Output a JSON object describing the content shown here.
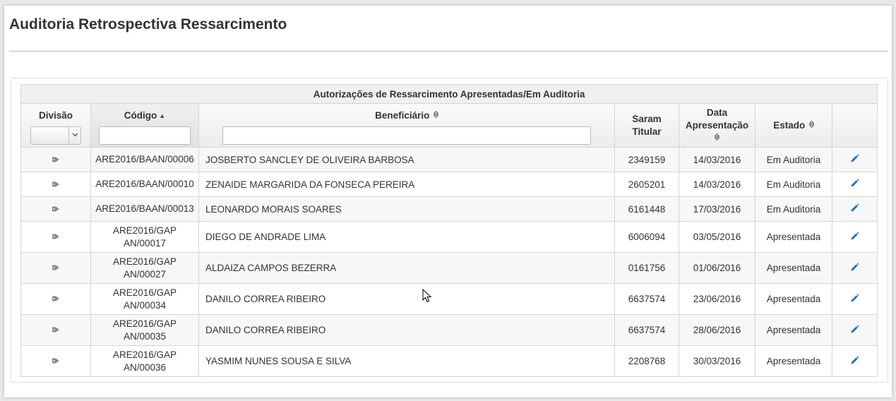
{
  "page": {
    "title": "Auditoria Retrospectiva Ressarcimento"
  },
  "table": {
    "caption": "Autorizações de Ressarcimento Apresentadas/Em Auditoria",
    "columns": {
      "divisao": "Divisão",
      "codigo": "Código",
      "beneficiario": "Beneficiário",
      "saram_1": "Saram",
      "saram_2": "Titular",
      "data_1": "Data",
      "data_2": "Apresentação",
      "estado": "Estado"
    },
    "sort": {
      "codigo": "asc",
      "sortable_icon": "sort-both-icon",
      "asc_icon": "sort-asc-icon"
    },
    "filters": {
      "divisao": "",
      "codigo": "",
      "beneficiario": ""
    },
    "rows": [
      {
        "codigo_1": "ARE2016/BAAN/00006",
        "codigo_2": "",
        "beneficiario": "JOSBERTO SANCLEY DE OLIVEIRA BARBOSA",
        "saram": "2349159",
        "data": "14/03/2016",
        "estado": "Em Auditoria"
      },
      {
        "codigo_1": "ARE2016/BAAN/00010",
        "codigo_2": "",
        "beneficiario": "ZENAIDE MARGARIDA DA FONSECA PEREIRA",
        "saram": "2605201",
        "data": "14/03/2016",
        "estado": "Em Auditoria"
      },
      {
        "codigo_1": "ARE2016/BAAN/00013",
        "codigo_2": "",
        "beneficiario": "LEONARDO MORAIS SOARES",
        "saram": "6161448",
        "data": "17/03/2016",
        "estado": "Em Auditoria"
      },
      {
        "codigo_1": "ARE2016/GAP",
        "codigo_2": "AN/00017",
        "beneficiario": "DIEGO DE ANDRADE LIMA",
        "saram": "6006094",
        "data": "03/05/2016",
        "estado": "Apresentada"
      },
      {
        "codigo_1": "ARE2016/GAP",
        "codigo_2": "AN/00027",
        "beneficiario": "ALDAIZA CAMPOS BEZERRA",
        "saram": "0161756",
        "data": "01/06/2016",
        "estado": "Apresentada"
      },
      {
        "codigo_1": "ARE2016/GAP",
        "codigo_2": "AN/00034",
        "beneficiario": "DANILO CORREA RIBEIRO",
        "saram": "6637574",
        "data": "23/06/2016",
        "estado": "Apresentada"
      },
      {
        "codigo_1": "ARE2016/GAP",
        "codigo_2": "AN/00035",
        "beneficiario": "DANILO CORREA RIBEIRO",
        "saram": "6637574",
        "data": "28/06/2016",
        "estado": "Apresentada"
      },
      {
        "codigo_1": "ARE2016/GAP",
        "codigo_2": "AN/00036",
        "beneficiario": "YASMIM NUNES SOUSA E SILVA",
        "saram": "2208768",
        "data": "30/03/2016",
        "estado": "Apresentada"
      }
    ],
    "row_icons": {
      "divisao": "tag-icon",
      "action": "pencil-edit-icon"
    }
  },
  "colors": {
    "edit_icon": "#1a6fc4",
    "tag_icon": "#8a8a8a"
  }
}
